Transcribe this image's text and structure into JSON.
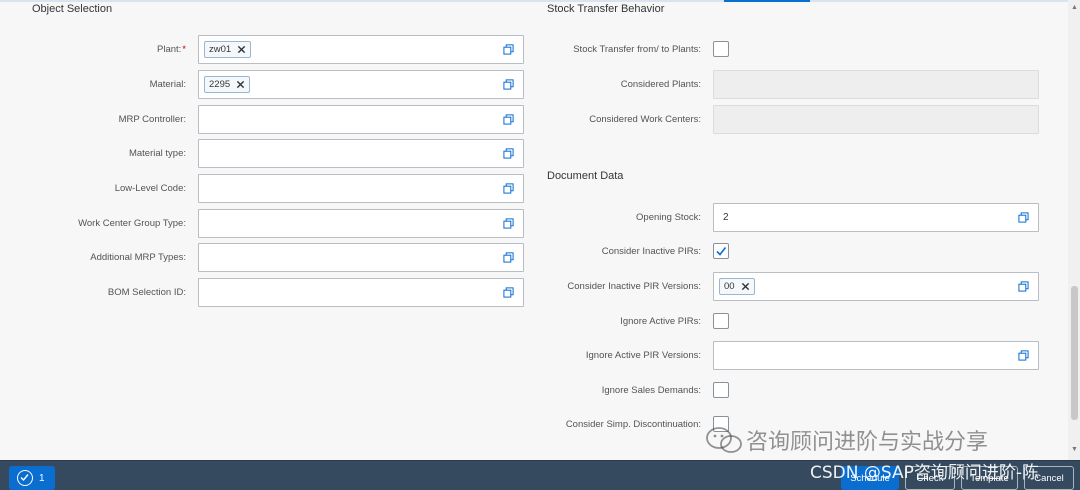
{
  "left_section": {
    "title": "Object Selection",
    "fields": [
      {
        "label": "Plant:",
        "required": "*",
        "token": "zw01"
      },
      {
        "label": "Material:",
        "token": "2295"
      },
      {
        "label": "MRP Controller:"
      },
      {
        "label": "Material type:"
      },
      {
        "label": "Low-Level Code:"
      },
      {
        "label": "Work Center Group Type:"
      },
      {
        "label": "Additional MRP Types:"
      },
      {
        "label": "BOM Selection ID:"
      }
    ]
  },
  "right_section": {
    "title": "Stock Transfer Behavior",
    "stock_transfer_label": "Stock Transfer from/ to Plants:",
    "stock_transfer_checked": false,
    "considered_plants_label": "Considered Plants:",
    "considered_work_centers_label": "Considered Work Centers:"
  },
  "document_data": {
    "title": "Document Data",
    "opening_stock_label": "Opening Stock:",
    "opening_stock_value": "2",
    "consider_inactive_pirs_label": "Consider Inactive PIRs:",
    "consider_inactive_pirs_checked": true,
    "consider_inactive_pir_versions_label": "Consider Inactive PIR Versions:",
    "consider_inactive_pir_versions_token": "00",
    "ignore_active_pirs_label": "Ignore Active PIRs:",
    "ignore_active_pir_versions_label": "Ignore Active PIR Versions:",
    "ignore_sales_demands_label": "Ignore Sales Demands:",
    "consider_simp_discontinuation_label": "Consider Simp. Discontinuation:"
  },
  "footer": {
    "message_count": "1",
    "schedule_label": "Schedule",
    "check_label": "Check",
    "template_label": "Template",
    "cancel_label": "Cancel"
  },
  "watermark": {
    "line1": "咨询顾问进阶与实战分享",
    "line2": "CSDN @SAP咨询顾问进阶-陈"
  },
  "colors": {
    "accent": "#0a6ed1",
    "footer_bg": "#354a5f",
    "required": "#bb0000"
  }
}
